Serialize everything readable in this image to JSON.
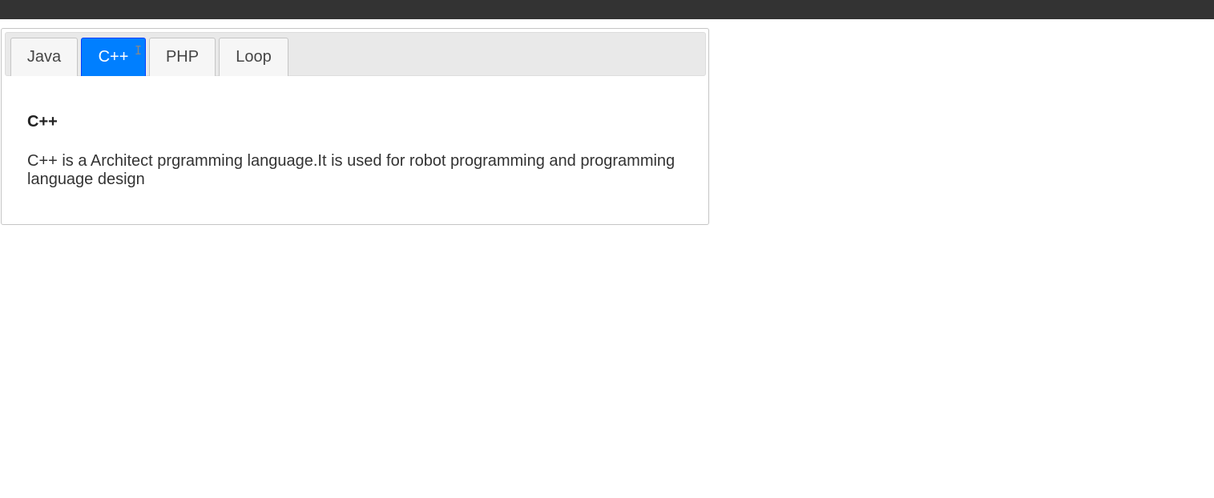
{
  "tabs": [
    {
      "label": "Java",
      "active": false
    },
    {
      "label": "C++",
      "active": true
    },
    {
      "label": "PHP",
      "active": false
    },
    {
      "label": "Loop",
      "active": false
    }
  ],
  "panel": {
    "title": "C++",
    "body": "C++ is a Architect prgramming language.It is used for robot programming and programming language design"
  },
  "colors": {
    "active_tab": "#007fff",
    "topbar": "#333333"
  }
}
